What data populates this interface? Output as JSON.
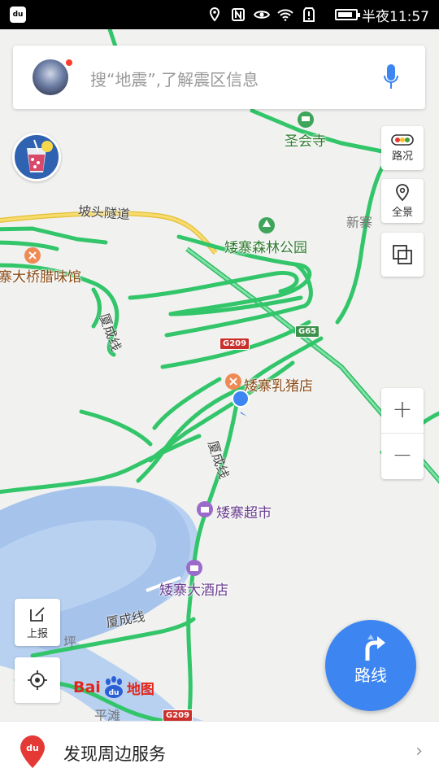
{
  "status_bar": {
    "app_icon": "du",
    "icons": [
      "location-icon",
      "nfc-icon",
      "eye-icon",
      "wifi-icon",
      "alert-icon",
      "battery-icon"
    ],
    "time": "半夜11:57"
  },
  "search": {
    "placeholder": "搜“地震”,了解震区信息",
    "has_notification_dot": true
  },
  "side_controls": {
    "traffic_label": "路况",
    "overview_label": "全景",
    "layers_icon": "layers-icon",
    "zoom_in": "+",
    "zoom_out": "−"
  },
  "left_controls": {
    "report_label": "上报",
    "locate_icon": "target-icon"
  },
  "route_button": {
    "label": "路线"
  },
  "map": {
    "labels": {
      "shenghui_temple": "圣会寺",
      "potou_tunnel": "坡头隧道",
      "xinzhai": "新寨",
      "aizhai_forest_park": "矮寨森林公园",
      "aizhai_bridge_restaurant": "寨大桥腊味馆",
      "xiacheng_line_1": "厦成线",
      "aizhai_suckling_pig": "矮寨乳猪店",
      "xiacheng_line_2": "厦成线",
      "aizhai_supermarket": "矮寨超市",
      "aizhai_hotel": "矮寨大酒店",
      "xiacheng_line_3": "厦成线",
      "ping_partial": "坪",
      "pingtan": "平滩"
    },
    "shields": {
      "g65": "G65",
      "g209_top": "G209",
      "g209_bottom": "G209"
    }
  },
  "baidu_logo": {
    "bai": "Bai",
    "du": "du",
    "map": "地图"
  },
  "bottom_bar": {
    "label": "发现周边服务",
    "pin_text": "du",
    "chevron": "›"
  },
  "colors": {
    "road_green": "#3ccf6e",
    "highway_yellow": "#f2d15a",
    "river": "#aecbf0",
    "accent_blue": "#3d86f2",
    "shield_green": "#3b8f4a",
    "shield_red": "#c9302c"
  }
}
